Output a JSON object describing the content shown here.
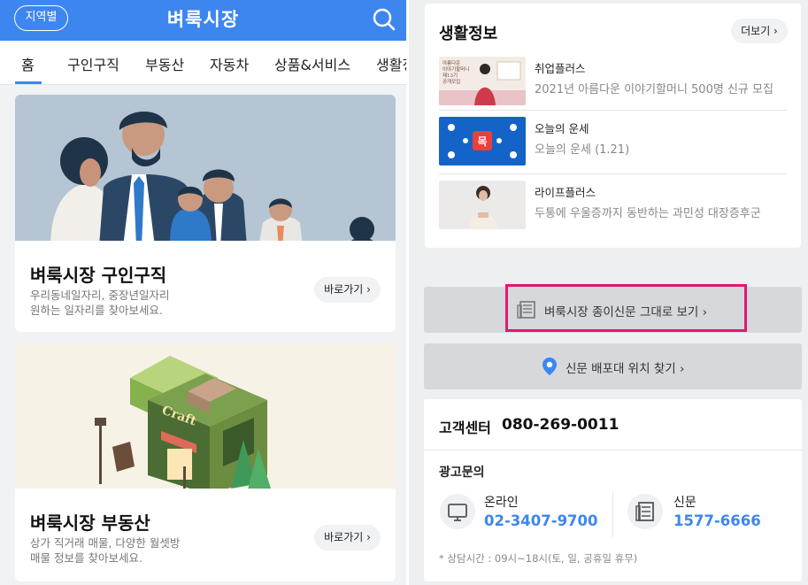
{
  "header": {
    "region_button": "지역별",
    "title": "벼룩시장"
  },
  "tabs": [
    "홈",
    "구인구직",
    "부동산",
    "자동차",
    "상품&서비스",
    "생활정"
  ],
  "cards": [
    {
      "title": "벼룩시장 구인구직",
      "desc_line1": "우리동네일자리, 중장년일자리",
      "desc_line2": "원하는 일자리를 찾아보세요.",
      "button": "바로가기 ›"
    },
    {
      "title": "벼룩시장 부동산",
      "desc_line1": "상가 직거래 매물, 다양한 월셋방",
      "desc_line2": "매물 정보를 찾아보세요.",
      "button": "바로가기 ›"
    }
  ],
  "life_info": {
    "title": "생활정보",
    "more_button": "더보기 ›",
    "items": [
      {
        "category": "취업플러스",
        "text": "2021년 아름다운 이야기할머니 500명 신규 모집",
        "thumb_text_lines": [
          "아름다운",
          "이야기할머니",
          "제13기",
          "공개모집"
        ]
      },
      {
        "category": "오늘의 운세",
        "text": "오늘의 운세 (1.21)",
        "thumb_badge": "목"
      },
      {
        "category": "라이프플러스",
        "text": "두통에 우울증까지 동반하는 과민성 대장증후군"
      }
    ]
  },
  "buttons": {
    "newspaper": "벼룩시장 종이신문 그대로 보기 ›",
    "stand_location": "신문 배포대 위치 찾기 ›"
  },
  "customer_center": {
    "label": "고객센터",
    "phone": "080-269-0011",
    "ad_label": "광고문의",
    "online_label": "온라인",
    "online_phone": "02-3407-9700",
    "paper_label": "신문",
    "paper_phone": "1577-6666",
    "hours": "* 상담시간 : 09시~18시(토, 일, 공휴일 휴무)"
  },
  "colors": {
    "brand_blue": "#3d86ef",
    "highlight": "#e5176f",
    "fortune_blue": "#1463c9",
    "fortune_badge": "#e8403a"
  }
}
